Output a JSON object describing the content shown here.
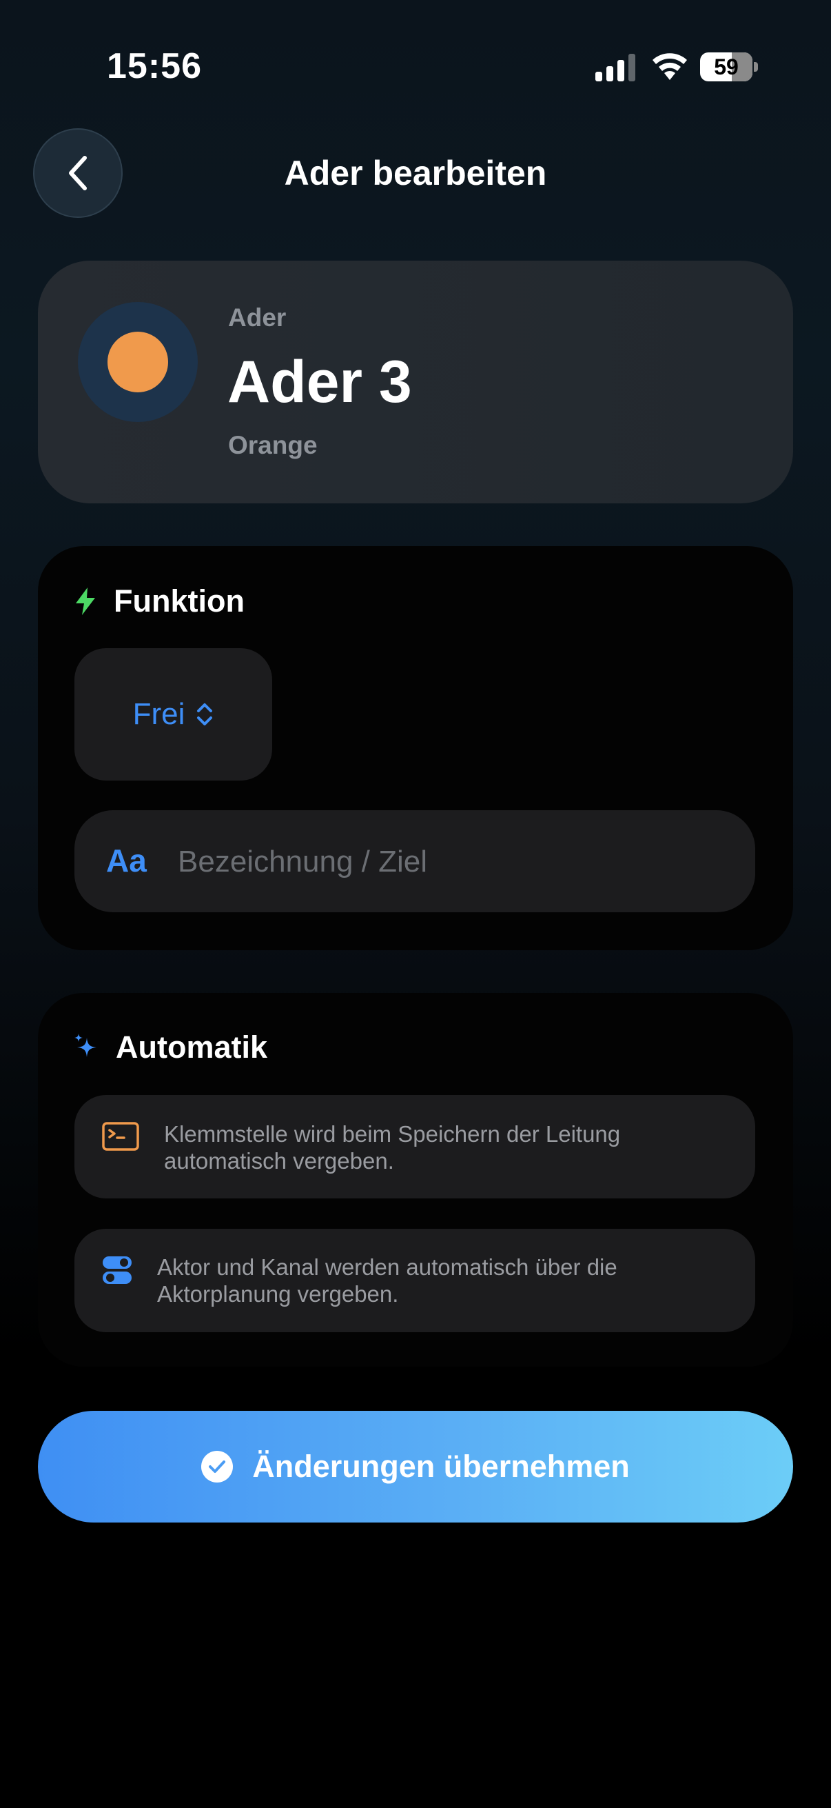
{
  "status_bar": {
    "time": "15:56",
    "battery": "59"
  },
  "header": {
    "title": "Ader bearbeiten",
    "back_icon": "chevron-left-icon"
  },
  "ader_card": {
    "label": "Ader",
    "name": "Ader 3",
    "color_name": "Orange",
    "color": "#f09a4c"
  },
  "funktion": {
    "title": "Funktion",
    "selected": "Frei",
    "input_icon": "Aa",
    "input_value": "",
    "input_placeholder": "Bezeichnung / Ziel"
  },
  "automatik": {
    "title": "Automatik",
    "items": [
      {
        "icon": "terminal-icon",
        "text": "Klemmstelle wird beim Speichern der Leitung automatisch vergeben."
      },
      {
        "icon": "toggles-icon",
        "text": "Aktor und Kanal werden automatisch über die Aktorplanung vergeben."
      }
    ]
  },
  "save_button": {
    "label": "Änderungen übernehmen"
  },
  "colors": {
    "accent": "#3e8ef7",
    "green": "#4cd964",
    "orange": "#f09a4c"
  }
}
